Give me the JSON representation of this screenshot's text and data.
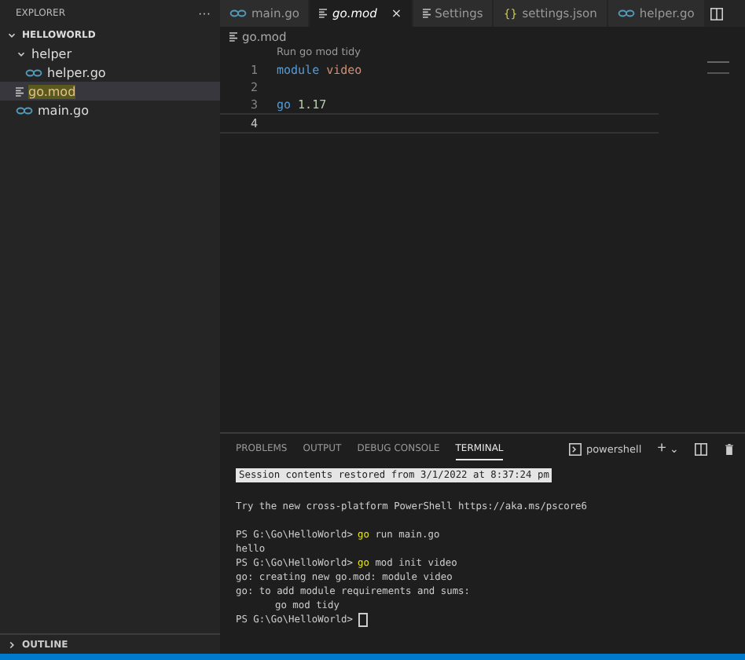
{
  "sidebar": {
    "title": "EXPLORER",
    "more": "···",
    "tree": [
      {
        "label": "HELLOWORLD",
        "kind": "root",
        "expanded": true,
        "selected": false,
        "children": [
          {
            "label": "helper",
            "kind": "folder",
            "expanded": true,
            "selected": false,
            "children": [
              {
                "label": "helper.go",
                "kind": "go",
                "selected": false
              }
            ]
          },
          {
            "label": "go.mod",
            "kind": "mod",
            "selected": true
          },
          {
            "label": "main.go",
            "kind": "go",
            "selected": false
          }
        ]
      }
    ],
    "outline": {
      "label": "OUTLINE",
      "expanded": false
    }
  },
  "tabs": [
    {
      "label": "main.go",
      "kind": "go",
      "selected": false,
      "preview": false
    },
    {
      "label": "go.mod",
      "kind": "mod",
      "selected": true,
      "preview": true,
      "close": "×"
    },
    {
      "label": "Settings",
      "kind": "mod",
      "selected": false,
      "preview": false
    },
    {
      "label": "settings.json",
      "kind": "json",
      "selected": false,
      "preview": false,
      "icon": "{}"
    },
    {
      "label": "helper.go",
      "kind": "go",
      "selected": false,
      "preview": false
    }
  ],
  "breadcrumb": "go.mod",
  "editor": {
    "codelens": "Run go mod tidy",
    "lines": [
      {
        "number": "1",
        "tokens": [
          {
            "text": "module",
            "kind": "keyword"
          },
          {
            "text": " video",
            "kind": "name"
          }
        ],
        "current": false
      },
      {
        "number": "2",
        "current": false
      },
      {
        "number": "3",
        "tokens": [
          {
            "text": "go",
            "kind": "keyword"
          },
          {
            "text": " 1.17",
            "kind": "number"
          }
        ],
        "current": false
      },
      {
        "number": "4",
        "current": true
      }
    ]
  },
  "panel": {
    "tabs": [
      {
        "label": "PROBLEMS",
        "selected": false
      },
      {
        "label": "OUTPUT",
        "selected": false
      },
      {
        "label": "DEBUG CONSOLE",
        "selected": false
      },
      {
        "label": "TERMINAL",
        "selected": true
      }
    ],
    "shell": "powershell",
    "add": "+",
    "dropdown": "⌄",
    "terminal": [
      {
        "kind": "banner",
        "text": "Session contents restored from 3/1/2022 at 8:37:24 pm"
      },
      {
        "kind": "blank"
      },
      {
        "kind": "output",
        "text": "Try the new cross-platform PowerShell https://aka.ms/pscore6"
      },
      {
        "kind": "blank"
      },
      {
        "kind": "prompt",
        "prompt": "PS G:\\Go\\HelloWorld>",
        "command": "go",
        "args": "run main.go"
      },
      {
        "kind": "output",
        "text": "hello"
      },
      {
        "kind": "prompt",
        "prompt": "PS G:\\Go\\HelloWorld>",
        "command": "go",
        "args": "mod init video"
      },
      {
        "kind": "output",
        "text": "go: creating new go.mod: module video"
      },
      {
        "kind": "output",
        "text": "go: to add module requirements and sums:"
      },
      {
        "kind": "indent",
        "text": "go mod tidy"
      },
      {
        "kind": "prompt",
        "prompt": "PS G:\\Go\\HelloWorld>",
        "cursor": true
      }
    ]
  }
}
